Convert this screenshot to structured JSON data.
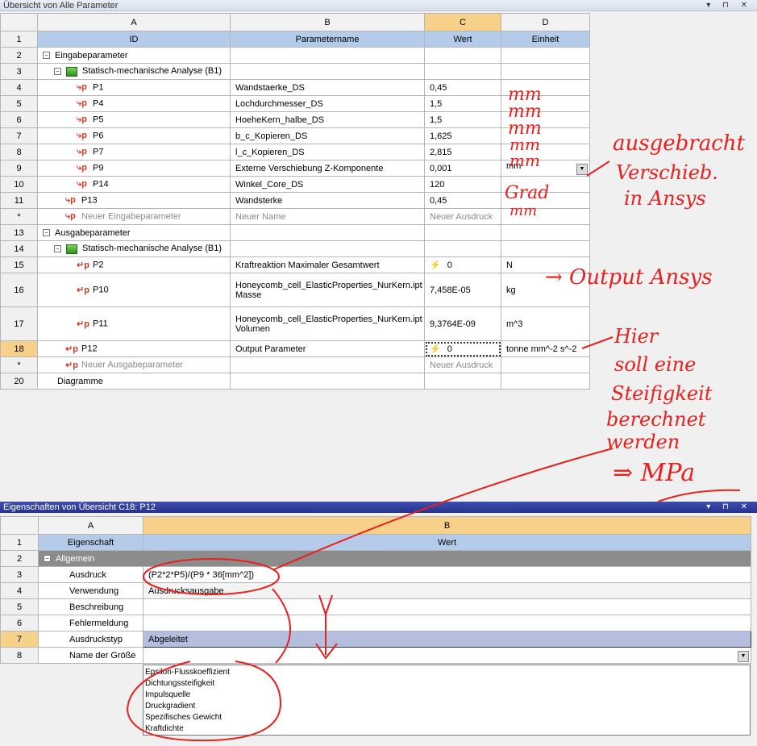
{
  "panel1": {
    "title": "Übersicht von Alle Parameter",
    "controls": "▾ ⊓ ✕"
  },
  "grid1": {
    "col_letters": [
      "A",
      "B",
      "C",
      "D"
    ],
    "col_labels": [
      "ID",
      "Parametername",
      "Wert",
      "Einheit"
    ],
    "rows": [
      {
        "n": "1"
      },
      {
        "n": "2",
        "id": "Eingabeparameter"
      },
      {
        "n": "3",
        "id": "Statisch-mechanische Analyse (B1)"
      },
      {
        "n": "4",
        "id": "P1",
        "name": "Wandstaerke_DS",
        "value": "0,45"
      },
      {
        "n": "5",
        "id": "P4",
        "name": "Lochdurchmesser_DS",
        "value": "1,5"
      },
      {
        "n": "6",
        "id": "P5",
        "name": "HoeheKern_halbe_DS",
        "value": "1,5"
      },
      {
        "n": "7",
        "id": "P6",
        "name": "b_c_Kopieren_DS",
        "value": "1,625"
      },
      {
        "n": "8",
        "id": "P7",
        "name": "l_c_Kopieren_DS",
        "value": "2,815"
      },
      {
        "n": "9",
        "id": "P9",
        "name": "Externe Verschiebung Z-Komponente",
        "value": "0,001",
        "unit": "mm"
      },
      {
        "n": "10",
        "id": "P14",
        "name": "Winkel_Core_DS",
        "value": "120"
      },
      {
        "n": "11",
        "id": "P13",
        "name": "Wandsterke",
        "value": "0,45"
      },
      {
        "n": "*",
        "id": "Neuer Eingabeparameter",
        "name": "Neuer Name",
        "value": "Neuer Ausdruck"
      },
      {
        "n": "13",
        "id": "Ausgabeparameter"
      },
      {
        "n": "14",
        "id": "Statisch-mechanische Analyse (B1)"
      },
      {
        "n": "15",
        "id": "P2",
        "name": "Kraftreaktion Maximaler Gesamtwert",
        "value": "0",
        "unit": "N"
      },
      {
        "n": "16",
        "id": "P10",
        "name1": "Honeycomb_cell_ElasticProperties_NurKern.ipt",
        "name2": "Masse",
        "value": "7,458E-05",
        "unit": "kg"
      },
      {
        "n": "17",
        "id": "P11",
        "name1": "Honeycomb_cell_ElasticProperties_NurKern.ipt",
        "name2": "Volumen",
        "value": "9,3764E-09",
        "unit": "m^3"
      },
      {
        "n": "18",
        "id": "P12",
        "name": "Output Parameter",
        "value": "0",
        "unit": "tonne mm^-2 s^-2"
      },
      {
        "n": "*",
        "id": "Neuer Ausgabeparameter",
        "value": "Neuer Ausdruck"
      },
      {
        "n": "20",
        "id": "Diagramme"
      }
    ]
  },
  "panel2": {
    "title": "Eigenschaften von Übersicht C18:  P12",
    "controls": "▾ ⊓ ✕"
  },
  "grid2": {
    "col_letters": [
      "A",
      "B"
    ],
    "col_labels": [
      "Eigenschaft",
      "Wert"
    ],
    "rows": [
      {
        "n": "1"
      },
      {
        "n": "2",
        "prop": "Allgemein"
      },
      {
        "n": "3",
        "prop": "Ausdruck",
        "value": "(P2*2*P5)/(P9 * 36[mm^2])"
      },
      {
        "n": "4",
        "prop": "Verwendung",
        "value": "Ausdrucksausgabe"
      },
      {
        "n": "5",
        "prop": "Beschreibung"
      },
      {
        "n": "6",
        "prop": "Fehlermeldung"
      },
      {
        "n": "7",
        "prop": "Ausdruckstyp",
        "value": "Abgeleitet"
      },
      {
        "n": "8",
        "prop": "Name der Größe"
      }
    ]
  },
  "dropdown_options": [
    "Epsilon-Flusskoeffizient",
    "Dichtungssteifigkeit",
    "Impulsquelle",
    "Druckgradient",
    "Spezifisches Gewicht",
    "Kraftdichte"
  ],
  "annotations": {
    "units_written": [
      "mm",
      "mm",
      "mm",
      "mm",
      "mm",
      "Grad",
      "mm"
    ],
    "note_top1": "ausgebracht",
    "note_top2": "Verschieb.",
    "note_top3": "in Ansys",
    "note_output": "→ Output Ansys",
    "note_hier1": "Hier",
    "note_hier2": "soll eine",
    "note_hier3": "Steifigkeit",
    "note_hier4": "berechnet",
    "note_hier5": "werden",
    "note_mpa": "⇒ MPa",
    "colors": {
      "ink": "#e8201e"
    }
  }
}
